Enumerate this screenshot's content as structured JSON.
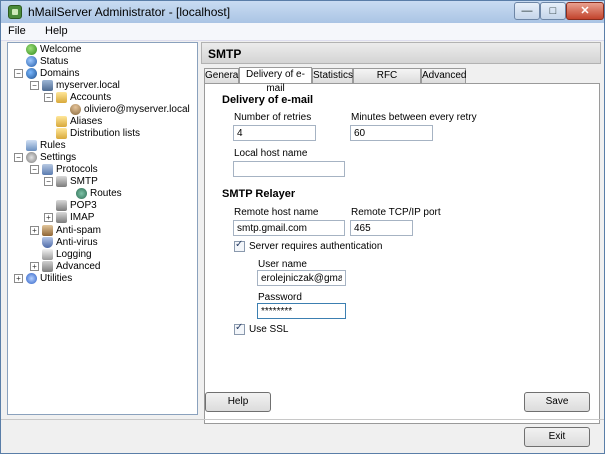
{
  "window": {
    "title": "hMailServer Administrator - [localhost]",
    "min_glyph": "—",
    "max_glyph": "□",
    "close_glyph": "✕"
  },
  "menu": {
    "file": "File",
    "help": "Help"
  },
  "tree": {
    "welcome": "Welcome",
    "status": "Status",
    "domains": "Domains",
    "domain": "myserver.local",
    "accounts": "Accounts",
    "account": "oliviero@myserver.local",
    "aliases": "Aliases",
    "distribution_lists": "Distribution lists",
    "rules": "Rules",
    "settings": "Settings",
    "protocols": "Protocols",
    "smtp": "SMTP",
    "routes": "Routes",
    "pop3": "POP3",
    "imap": "IMAP",
    "anti_spam": "Anti-spam",
    "anti_virus": "Anti-virus",
    "logging": "Logging",
    "advanced": "Advanced",
    "utilities": "Utilities",
    "expanded_glyph": "−",
    "collapsed_glyph": "+"
  },
  "header": {
    "title": "SMTP"
  },
  "tabs": {
    "general": "General",
    "delivery": "Delivery of e-mail",
    "statistics": "Statistics",
    "rfc": "RFC compliance",
    "advanced": "Advanced"
  },
  "delivery": {
    "section": "Delivery of e-mail",
    "retries_label": "Number of retries",
    "retries_value": "4",
    "minutes_label": "Minutes between every retry",
    "minutes_value": "60",
    "localhost_label": "Local host name",
    "localhost_value": ""
  },
  "relayer": {
    "section": "SMTP Relayer",
    "host_label": "Remote host name",
    "host_value": "smtp.gmail.com",
    "port_label": "Remote TCP/IP port",
    "port_value": "465",
    "auth_label": "Server requires authentication",
    "auth_checked": true,
    "username_label": "User name",
    "username_value": "erolejniczak@gmail.com",
    "password_label": "Password",
    "password_value": "********",
    "ssl_label": "Use SSL",
    "ssl_checked": true
  },
  "buttons": {
    "help": "Help",
    "save": "Save",
    "exit": "Exit"
  }
}
